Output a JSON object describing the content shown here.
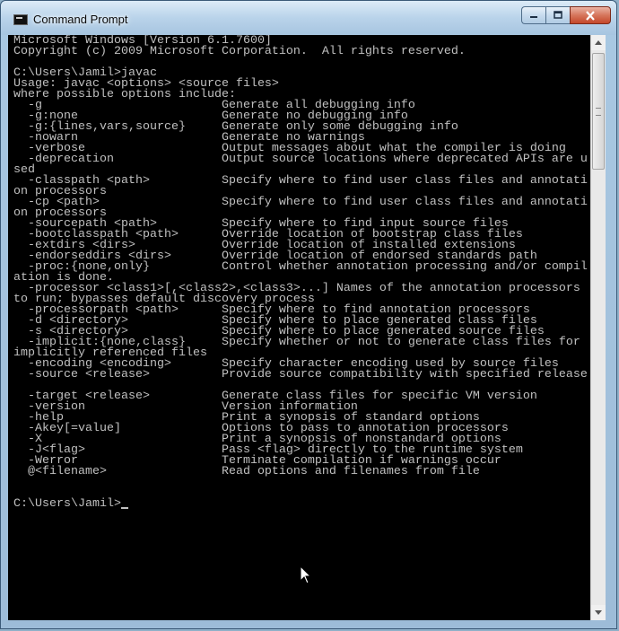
{
  "window": {
    "title": "Command Prompt",
    "icon": "cmd-window-icon",
    "controls": {
      "minimize": "minimize-icon",
      "maximize": "maximize-icon",
      "close": "close-icon"
    }
  },
  "console": {
    "lines": [
      "Microsoft Windows [Version 6.1.7600]",
      "Copyright (c) 2009 Microsoft Corporation.  All rights reserved.",
      "",
      "C:\\Users\\Jamil>javac",
      "Usage: javac <options> <source files>",
      "where possible options include:",
      "  -g                         Generate all debugging info",
      "  -g:none                    Generate no debugging info",
      "  -g:{lines,vars,source}     Generate only some debugging info",
      "  -nowarn                    Generate no warnings",
      "  -verbose                   Output messages about what the compiler is doing",
      "  -deprecation               Output source locations where deprecated APIs are u",
      "sed",
      "  -classpath <path>          Specify where to find user class files and annotati",
      "on processors",
      "  -cp <path>                 Specify where to find user class files and annotati",
      "on processors",
      "  -sourcepath <path>         Specify where to find input source files",
      "  -bootclasspath <path>      Override location of bootstrap class files",
      "  -extdirs <dirs>            Override location of installed extensions",
      "  -endorseddirs <dirs>       Override location of endorsed standards path",
      "  -proc:{none,only}          Control whether annotation processing and/or compil",
      "ation is done.",
      "  -processor <class1>[,<class2>,<class3>...] Names of the annotation processors",
      "to run; bypasses default discovery process",
      "  -processorpath <path>      Specify where to find annotation processors",
      "  -d <directory>             Specify where to place generated class files",
      "  -s <directory>             Specify where to place generated source files",
      "  -implicit:{none,class}     Specify whether or not to generate class files for",
      "implicitly referenced files",
      "  -encoding <encoding>       Specify character encoding used by source files",
      "  -source <release>          Provide source compatibility with specified release",
      "",
      "  -target <release>          Generate class files for specific VM version",
      "  -version                   Version information",
      "  -help                      Print a synopsis of standard options",
      "  -Akey[=value]              Options to pass to annotation processors",
      "  -X                         Print a synopsis of nonstandard options",
      "  -J<flag>                   Pass <flag> directly to the runtime system",
      "  -Werror                    Terminate compilation if warnings occur",
      "  @<filename>                Read options and filenames from file",
      "",
      "",
      "C:\\Users\\Jamil>"
    ]
  },
  "scrollbar": {
    "up": "scroll-up-arrow-icon",
    "down": "scroll-down-arrow-icon"
  }
}
